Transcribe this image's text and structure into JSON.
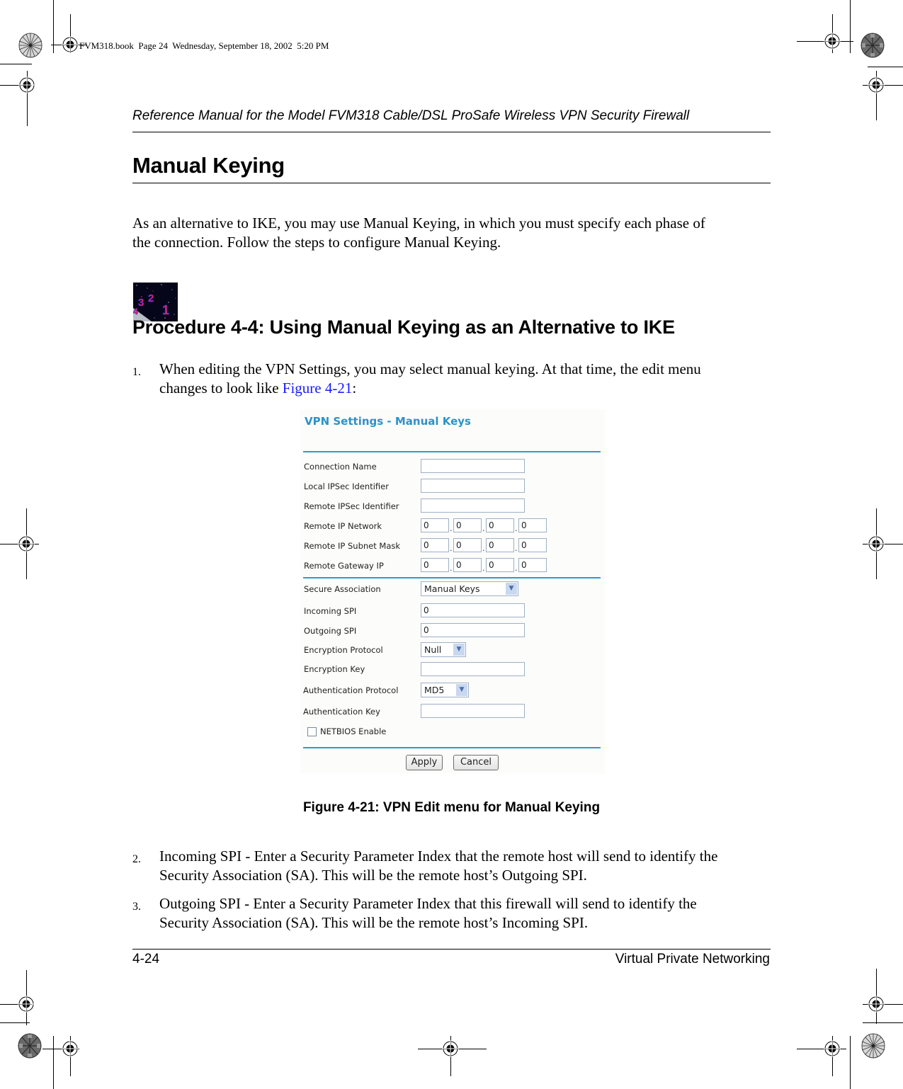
{
  "print_info": "FVM318.book  Page 24  Wednesday, September 18, 2002  5:20 PM",
  "running_head": "Reference Manual for the Model FVM318 Cable/DSL ProSafe Wireless VPN Security Firewall",
  "section_title": "Manual Keying",
  "intro_paragraph": {
    "line1": "As an alternative to IKE, you may use Manual Keying, in which you must specify each phase of",
    "line2": "the connection. Follow the steps to configure Manual Keying."
  },
  "procedure": {
    "icon": "procedure-countdown-icon",
    "title": "Procedure 4-4:  Using Manual Keying as an Alternative to IKE"
  },
  "steps": [
    {
      "number": "1.",
      "line1": "When editing the VPN Settings, you may select manual keying. At that time, the edit menu",
      "line2_prefix": "changes to look like ",
      "link": "Figure 4-21",
      "line2_suffix": ":"
    },
    {
      "number": "2.",
      "line1": "Incoming SPI - Enter a Security Parameter Index that the remote host will send to identify the",
      "line2": "Security Association (SA). This will be the remote host’s Outgoing SPI."
    },
    {
      "number": "3.",
      "line1": "Outgoing SPI - Enter a Security Parameter Index that this firewall will send to identify the",
      "line2": "Security Association (SA). This will be the remote host’s Incoming SPI."
    }
  ],
  "figure": {
    "title": "VPN Settings - Manual Keys",
    "accent_color": "#2d9ccc",
    "fields": {
      "connection_name": {
        "label": "Connection Name",
        "value": ""
      },
      "local_ipsec_id": {
        "label": "Local IPSec Identifier",
        "value": ""
      },
      "remote_ipsec_id": {
        "label": "Remote IPSec Identifier",
        "value": ""
      },
      "remote_ip_network": {
        "label": "Remote IP Network",
        "octets": [
          "0",
          "0",
          "0",
          "0"
        ]
      },
      "remote_ip_subnet_mask": {
        "label": "Remote IP Subnet Mask",
        "octets": [
          "0",
          "0",
          "0",
          "0"
        ]
      },
      "remote_gateway_ip": {
        "label": "Remote Gateway IP",
        "octets": [
          "0",
          "0",
          "0",
          "0"
        ]
      },
      "secure_association": {
        "label": "Secure Association",
        "selected": "Manual Keys"
      },
      "incoming_spi": {
        "label": "Incoming SPI",
        "value": "0"
      },
      "outgoing_spi": {
        "label": "Outgoing SPI",
        "value": "0"
      },
      "encryption_protocol": {
        "label": "Encryption Protocol",
        "selected": "Null"
      },
      "encryption_key": {
        "label": "Encryption Key",
        "value": ""
      },
      "authentication_protocol": {
        "label": "Authentication Protocol",
        "selected": "MD5"
      },
      "authentication_key": {
        "label": "Authentication Key",
        "value": ""
      },
      "netbios_enable": {
        "label": "NETBIOS Enable",
        "checked": false
      }
    },
    "buttons": {
      "apply": "Apply",
      "cancel": "Cancel"
    },
    "dot": "."
  },
  "figure_caption": "Figure 4-21:  VPN Edit menu for Manual Keying",
  "footer": {
    "page_number": "4-24",
    "chapter": "Virtual Private Networking"
  }
}
